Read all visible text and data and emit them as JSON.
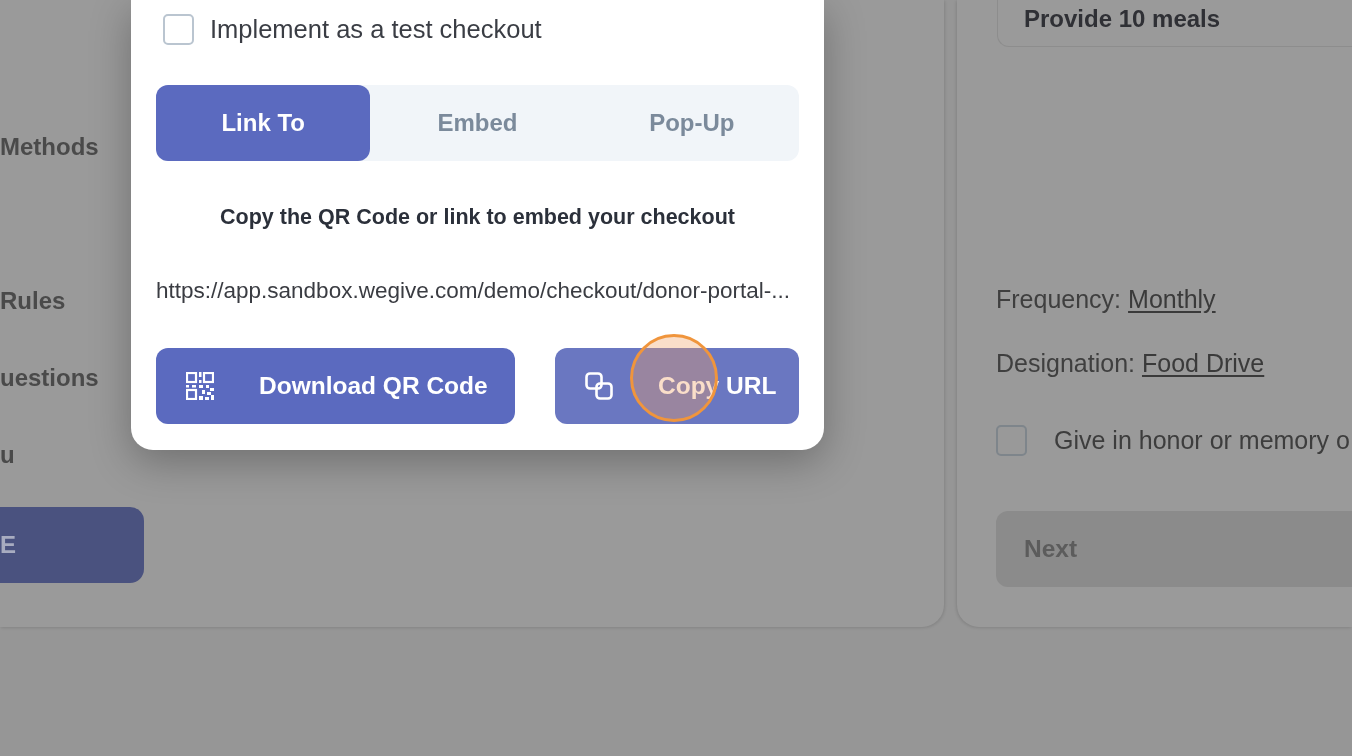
{
  "sidebar": {
    "items": [
      {
        "label": "Methods"
      },
      {
        "label": "Rules"
      },
      {
        "label": "uestions"
      },
      {
        "label": "u"
      }
    ],
    "button": {
      "label": "E"
    }
  },
  "dialog": {
    "test_checkout": {
      "label": "Implement as a test checkout",
      "checked": false
    },
    "tabs": [
      {
        "label": "Link To",
        "selected": true
      },
      {
        "label": "Embed",
        "selected": false
      },
      {
        "label": "Pop-Up",
        "selected": false
      }
    ],
    "instruction": "Copy the QR Code or link to embed your checkout",
    "url": "https://app.sandbox.wegive.com/demo/checkout/donor-portal-...",
    "buttons": [
      {
        "kind": "qr",
        "label": "Download QR Code",
        "clicked": false
      },
      {
        "kind": "copy",
        "label": "Copy URL",
        "clicked": true
      }
    ]
  },
  "checkout_preview": {
    "selected_option": "Provide 10 meals",
    "details": [
      {
        "label": "Frequency:",
        "value": "Monthly"
      },
      {
        "label": "Designation:",
        "value": "Food Drive"
      }
    ],
    "tribute": {
      "label": "Give in honor or memory o",
      "checked": false
    },
    "next_button": {
      "label": "Next",
      "disabled": true
    }
  }
}
